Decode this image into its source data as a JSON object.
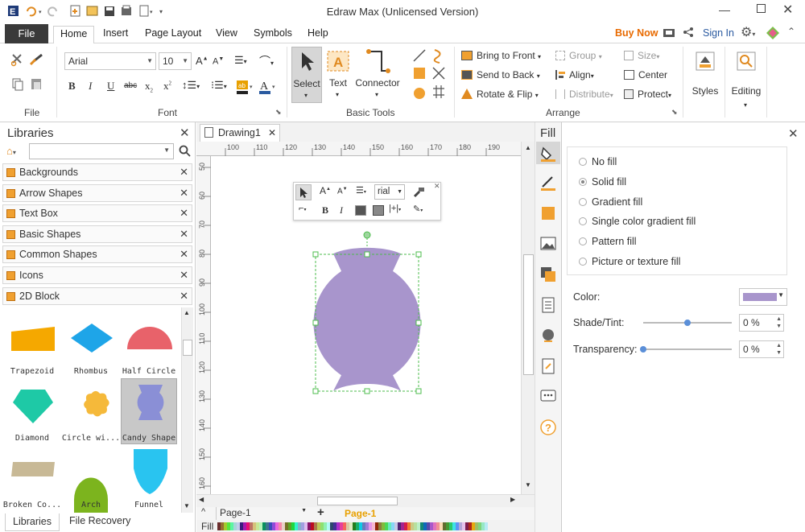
{
  "window": {
    "title": "Edraw Max (Unlicensed Version)"
  },
  "menu": {
    "file": "File",
    "home": "Home",
    "insert": "Insert",
    "page_layout": "Page Layout",
    "view": "View",
    "symbols": "Symbols",
    "help": "Help",
    "buy_now": "Buy Now",
    "sign_in": "Sign In"
  },
  "font": {
    "family": "Arial",
    "size": "10"
  },
  "groups": {
    "file": "File",
    "font": "Font",
    "basic_tools": "Basic Tools",
    "arrange": "Arrange"
  },
  "tools": {
    "select": "Select",
    "text": "Text",
    "connector": "Connector",
    "styles": "Styles",
    "editing": "Editing"
  },
  "arrange": {
    "bring_to_front": "Bring to Front",
    "send_to_back": "Send to Back",
    "rotate_flip": "Rotate & Flip",
    "group": "Group",
    "align": "Align",
    "distribute": "Distribute",
    "size": "Size",
    "center": "Center",
    "protect": "Protect"
  },
  "libraries": {
    "title": "Libraries",
    "items": [
      "Backgrounds",
      "Arrow Shapes",
      "Text Box",
      "Basic Shapes",
      "Common Shapes",
      "Icons",
      "2D Block"
    ],
    "shapes": [
      "Trapezoid",
      "Rhombus",
      "Half Circle",
      "Diamond",
      "Circle wi...",
      "Candy Shape",
      "Broken Co...",
      "Arch",
      "Funnel"
    ],
    "bottom_tabs": [
      "Libraries",
      "File Recovery"
    ]
  },
  "document": {
    "tab": "Drawing1",
    "ruler_h": [
      "100",
      "110",
      "120",
      "130",
      "140",
      "150",
      "160",
      "170",
      "180",
      "190"
    ],
    "ruler_v": [
      "50",
      "60",
      "70",
      "80",
      "90",
      "100",
      "110",
      "120",
      "130",
      "140",
      "150",
      "160"
    ],
    "float_font": "rial",
    "page_selector": "Page-1",
    "page_tab": "Page-1",
    "fill_label": "Fill"
  },
  "fill_panel": {
    "title": "Fill",
    "options": [
      "No fill",
      "Solid fill",
      "Gradient fill",
      "Single color gradient fill",
      "Pattern fill",
      "Picture or texture fill"
    ],
    "selected": 1,
    "color_label": "Color:",
    "color_value": "#a895cc",
    "shade_label": "Shade/Tint:",
    "shade_value": "0 %",
    "shade_level": 0.5,
    "transparency_label": "Transparency:",
    "transparency_value": "0 %",
    "transparency_level": 0
  },
  "colors": {
    "accent": "#e8a000",
    "shape": "#a895cc",
    "buy_now": "#e86a00",
    "page_tab": "#e8a000"
  }
}
